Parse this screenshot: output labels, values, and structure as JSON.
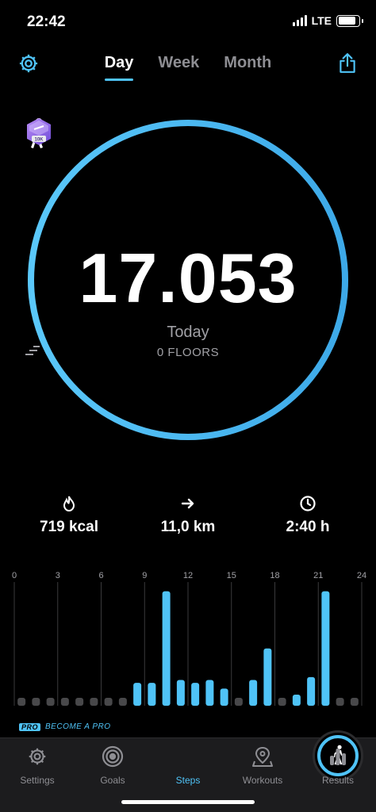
{
  "status_bar": {
    "time": "22:42",
    "network": "LTE",
    "battery_fraction": 0.85
  },
  "header": {
    "tabs": [
      {
        "label": "Day",
        "active": true
      },
      {
        "label": "Week",
        "active": false
      },
      {
        "label": "Month",
        "active": false
      }
    ],
    "icons": {
      "settings": "gear-icon",
      "share": "share-icon"
    }
  },
  "summary": {
    "steps": "17.053",
    "day_label": "Today",
    "floors": "0 FLOORS",
    "goal_progress": 1.0,
    "badge": "10K"
  },
  "stats": [
    {
      "icon": "flame-icon",
      "value": "719 kcal"
    },
    {
      "icon": "arrow-right-icon",
      "value": "11,0 km"
    },
    {
      "icon": "clock-icon",
      "value": "2:40 h"
    }
  ],
  "chart_data": {
    "type": "bar",
    "x_ticks": [
      "0",
      "3",
      "6",
      "9",
      "12",
      "15",
      "18",
      "21",
      "24"
    ],
    "hours": [
      0,
      1,
      2,
      3,
      4,
      5,
      6,
      7,
      8,
      9,
      10,
      11,
      12,
      13,
      14,
      15,
      16,
      17,
      18,
      19,
      20,
      21,
      22,
      23
    ],
    "values": [
      0,
      0,
      0,
      0,
      0,
      0,
      0,
      0,
      160,
      160,
      800,
      180,
      160,
      180,
      120,
      0,
      180,
      400,
      0,
      60,
      200,
      800,
      0,
      0
    ],
    "active_color": "#4fc3f7",
    "inactive_color": "#48484a",
    "ylim": [
      0,
      820
    ]
  },
  "promo": {
    "tag": "PRO",
    "text": "BECOME A PRO"
  },
  "tab_bar": [
    {
      "label": "Settings",
      "icon": "gear-icon",
      "active": false
    },
    {
      "label": "Goals",
      "icon": "target-icon",
      "active": false
    },
    {
      "label": "Steps",
      "icon": "walker-icon",
      "active": true
    },
    {
      "label": "Workouts",
      "icon": "map-pin-icon",
      "active": false
    },
    {
      "label": "Results",
      "icon": "bar-chart-icon",
      "active": false
    }
  ],
  "colors": {
    "accent": "#4fc3f7",
    "muted": "#8e8e93",
    "background": "#000000"
  }
}
